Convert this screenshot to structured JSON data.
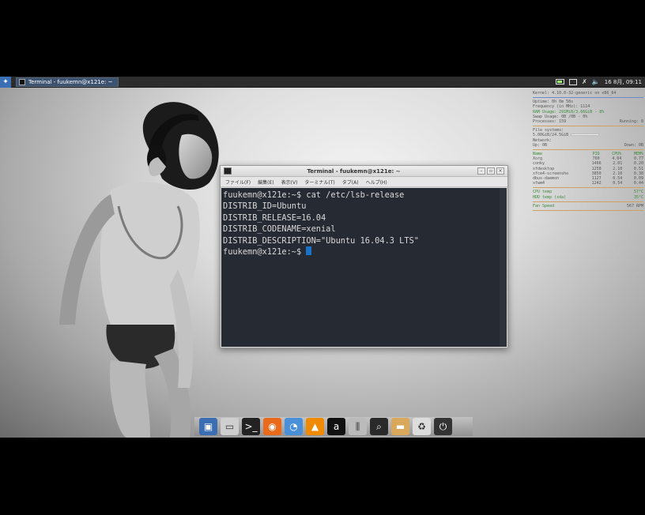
{
  "panel": {
    "menu_icon": "whisker-menu-icon",
    "task_title": "Terminal - fuukemn@x121e: ~",
    "datetime": "16 8月, 09:11"
  },
  "terminal": {
    "title": "Terminal - fuukemn@x121e: ~",
    "menu": [
      "ファイル(F)",
      "編集(E)",
      "表示(V)",
      "ターミナル(T)",
      "タブ(A)",
      "ヘルプ(H)"
    ],
    "lines": [
      "fuukemn@x121e:~$ cat /etc/lsb-release",
      "DISTRIB_ID=Ubuntu",
      "DISTRIB_RELEASE=16.04",
      "DISTRIB_CODENAME=xenial",
      "DISTRIB_DESCRIPTION=\"Ubuntu 16.04.3 LTS\""
    ],
    "prompt": "fuukemn@x121e:~$ "
  },
  "conky": {
    "kernel": "Kernel: 4.10.0-32-generic on x86_64",
    "uptime": "Uptime: 0h 0m 58s",
    "freq": "Frequency (in MHz): 1114",
    "ram": "RAM Usage: 291MiB/3.66GiB - 8%",
    "swap": "Swap Usage: 0B /0B - 0%",
    "processes": "Processes: 159",
    "running": "Running: 0",
    "fs_title": "File systems:",
    "fs_value": "5.00GiB/24.5GiB",
    "network": "Network:",
    "down": "Up: 0B",
    "up": "Down: 0B",
    "proc_header": [
      "Name",
      "PID",
      "CPU%",
      "MEM%"
    ],
    "procs": [
      [
        "Xorg",
        "760",
        "4.04",
        "0.77"
      ],
      [
        "conky",
        "1466",
        "2.01",
        "0.20"
      ],
      [
        "xfdesktop",
        "1258",
        "2.10",
        "0.51"
      ],
      [
        "xfce4-screensho",
        "3850",
        "2.10",
        "0.38"
      ],
      [
        "dbus-daemon",
        "1127",
        "0.54",
        "0.09"
      ],
      [
        "xfwm4",
        "1242",
        "0.54",
        "0.44"
      ]
    ],
    "temps": [
      [
        "CPU temp",
        "57°C"
      ],
      [
        "HDD temp (sda)",
        "35°C"
      ]
    ],
    "fan_label": "Fan Speed",
    "fan_value": "567 RPM"
  },
  "dock": {
    "icons": [
      "desktop-icon",
      "drive-icon",
      "terminal-icon",
      "firefox-icon",
      "messaging-icon",
      "vlc-icon",
      "amazon-icon",
      "mixer-icon",
      "search-icon",
      "folder-icon",
      "trash-icon",
      "logout-icon"
    ],
    "colors": [
      "#3b6db3",
      "#cfcfcf",
      "#222222",
      "#e86a1a",
      "#4a90d9",
      "#f08a00",
      "#111111",
      "#bbbbbb",
      "#2a2a2a",
      "#d9a85a",
      "#dddddd",
      "#333333"
    ],
    "glyphs": [
      "▣",
      "▭",
      ">_",
      "◉",
      "◔",
      "▲",
      "a",
      "⫼",
      "⌕",
      "▬",
      "♻",
      "⏻"
    ]
  }
}
